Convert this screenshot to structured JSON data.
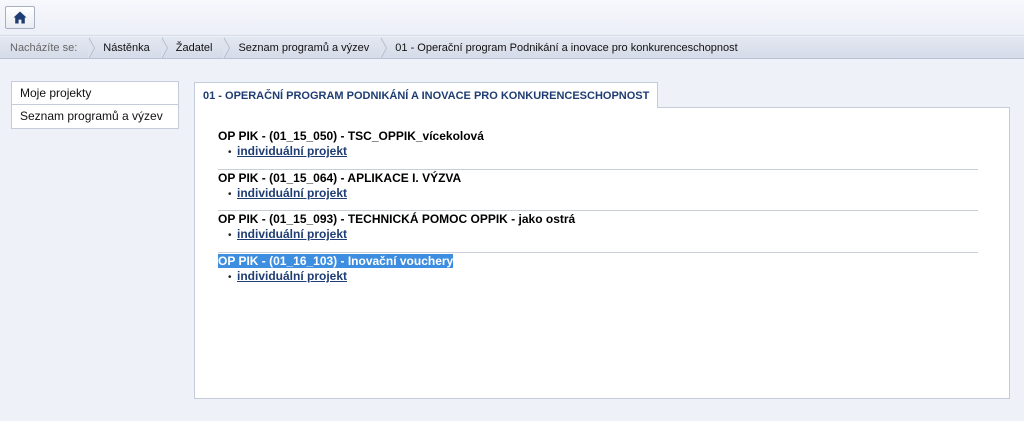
{
  "breadcrumb": {
    "items": [
      "Nacházíte se:",
      "Nástěnka",
      "Žadatel",
      "Seznam programů a výzev",
      "01 - Operační program Podnikání a inovace pro konkurenceschopnost"
    ]
  },
  "sidebar": {
    "items": [
      "Moje projekty",
      "Seznam programů a výzev"
    ]
  },
  "tab": {
    "label": "01 - OPERAČNÍ PROGRAM PODNIKÁNÍ A INOVACE PRO KONKURENCESCHOPNOST"
  },
  "programs": [
    {
      "title": "OP PIK - (01_15_050) - TSC_OPPIK_vícekolová",
      "link": "individuální projekt"
    },
    {
      "title": "OP PIK - (01_15_064) - APLIKACE I. VÝZVA",
      "link": "individuální projekt"
    },
    {
      "title": "OP PIK - (01_15_093) - TECHNICKÁ POMOC OPPIK - jako ostrá",
      "link": "individuální projekt"
    },
    {
      "title": "OP PIK - (01_16_103) - Inovační vouchery",
      "link": "individuální projekt"
    }
  ],
  "colors": {
    "accent": "#1f3d73",
    "selection": "#3d8ee0"
  },
  "icons": {
    "home": "home-icon"
  }
}
